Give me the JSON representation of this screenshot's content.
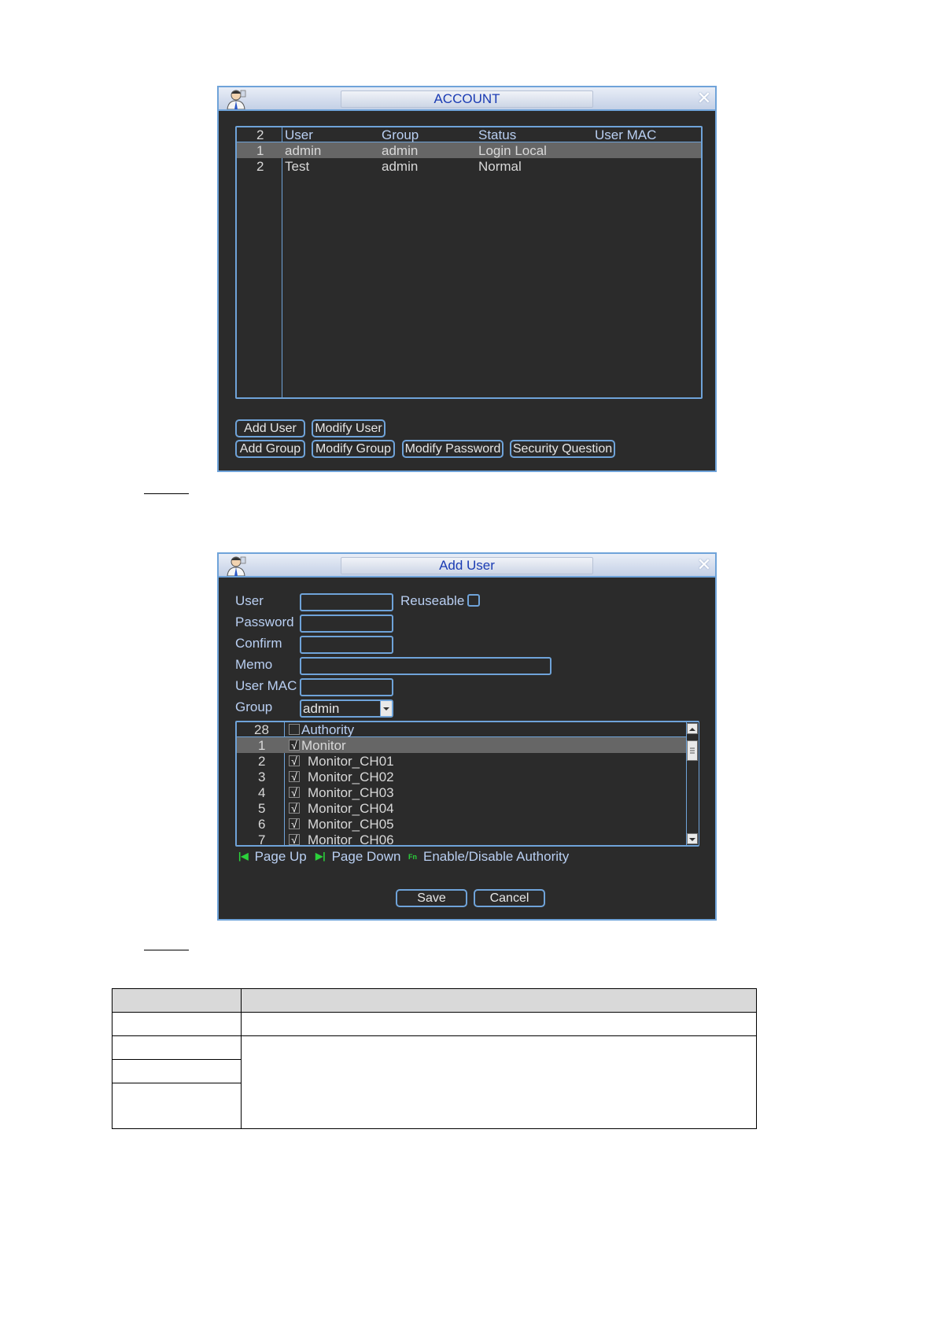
{
  "account_window": {
    "title": "ACCOUNT",
    "table": {
      "headers": [
        "2",
        "User",
        "Group",
        "Status",
        "User MAC"
      ],
      "rows": [
        {
          "num": "1",
          "user": "admin",
          "group": "admin",
          "status": "Login Local",
          "mac": ""
        },
        {
          "num": "2",
          "user": "Test",
          "group": "admin",
          "status": "Normal",
          "mac": ""
        }
      ]
    },
    "buttons": {
      "add_user": "Add User",
      "modify_user": "Modify User",
      "add_group": "Add Group",
      "modify_group": "Modify Group",
      "modify_password": "Modify Password",
      "security_question": "Security Question"
    }
  },
  "add_user_window": {
    "title": "Add User",
    "form": {
      "user_label": "User",
      "user_value": "",
      "reuseable_label": "Reuseable",
      "password_label": "Password",
      "confirm_label": "Confirm",
      "memo_label": "Memo",
      "user_mac_label": "User MAC",
      "group_label": "Group",
      "group_value": "admin"
    },
    "authority": {
      "count": "28",
      "header": "Authority",
      "rows": [
        {
          "num": "1",
          "label": "Monitor"
        },
        {
          "num": "2",
          "label": "Monitor_CH01"
        },
        {
          "num": "3",
          "label": "Monitor_CH02"
        },
        {
          "num": "4",
          "label": "Monitor_CH03"
        },
        {
          "num": "5",
          "label": "Monitor_CH04"
        },
        {
          "num": "6",
          "label": "Monitor_CH05"
        },
        {
          "num": "7",
          "label": "Monitor_CH06"
        }
      ],
      "check_mark": "√"
    },
    "hints": {
      "page_up": "Page Up",
      "page_down": "Page Down",
      "fn_icon": "Fn",
      "enable_disable": "Enable/Disable Authority"
    },
    "buttons": {
      "save": "Save",
      "cancel": "Cancel"
    }
  },
  "colors": {
    "window_bg": "#2b2b2b",
    "border_blue": "#6fa3d9",
    "title_text": "#1a3bb3",
    "label_text": "#b9cff2",
    "selected_row": "#666666",
    "hint_icon_green": "#2bd13b"
  }
}
